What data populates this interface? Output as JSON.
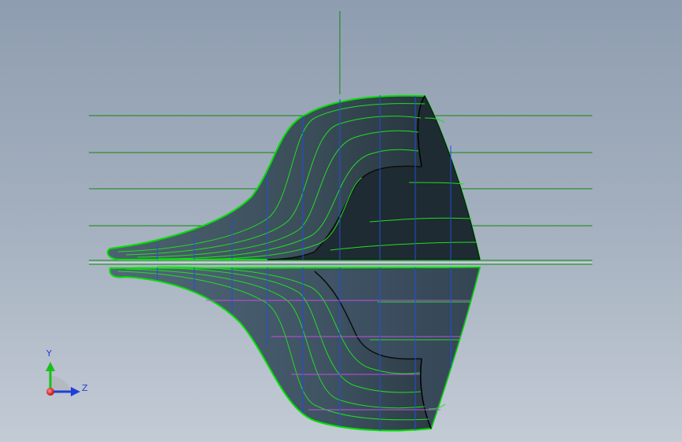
{
  "viewport": {
    "background_top": "#8e9db0",
    "background_bottom": "#c3cbd5"
  },
  "model": {
    "surface_color": "#34454f",
    "edge_color": "#00e000",
    "isoline_color": "#22dd22",
    "section_line_blue": "#1e4fd8",
    "section_line_magenta": "#c050e0",
    "reference_plane_color": "#118811"
  },
  "triad": {
    "y_label": "Y",
    "z_label": "Z",
    "y_axis_color": "#18c018",
    "z_axis_color": "#1f3fd8",
    "origin_color": "#e02020"
  }
}
